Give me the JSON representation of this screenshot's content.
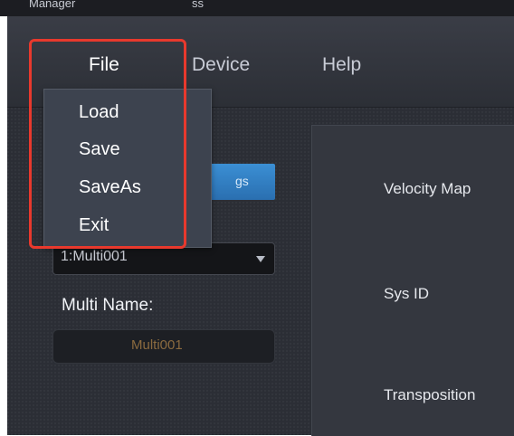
{
  "top_strip": {
    "left_text": "Manager",
    "right_text": "ss"
  },
  "menubar": {
    "file": "File",
    "device": "Device",
    "help": "Help"
  },
  "file_menu": {
    "items": [
      "Load",
      "Save",
      "SaveAs",
      "Exit"
    ]
  },
  "left_panel": {
    "blue_button_text": "gs",
    "select_value": "1:Multi001",
    "multi_name_label": "Multi Name:",
    "multi_name_value": "Multi001"
  },
  "right_panel": {
    "labels": [
      "Velocity Map",
      "Sys ID",
      "Transposition"
    ]
  },
  "colors": {
    "highlight": "#e8392d",
    "accent_button": "#2a6fb0"
  }
}
